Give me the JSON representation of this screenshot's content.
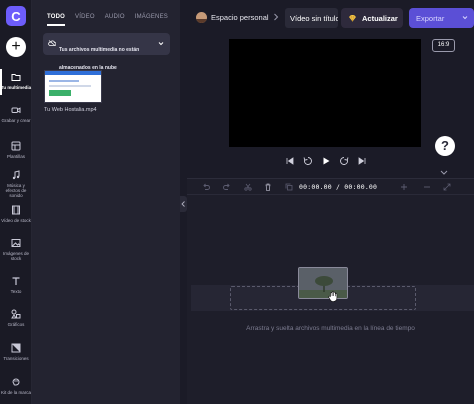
{
  "rail": {
    "logo_letter": "C",
    "add_label": "+",
    "items": [
      {
        "label": "Tu multimedia",
        "icon": "folder-icon",
        "active": true
      },
      {
        "label": "Grabar y crear",
        "icon": "video-camera-icon"
      },
      {
        "label": "Plantillas",
        "icon": "templates-icon"
      },
      {
        "label": "Música y efectos de sonido",
        "icon": "music-note-icon"
      },
      {
        "label": "Vídeo de stock",
        "icon": "film-icon"
      },
      {
        "label": "Imágenes de stock",
        "icon": "image-icon"
      },
      {
        "label": "Texto",
        "icon": "text-icon"
      },
      {
        "label": "Gráficos",
        "icon": "shapes-icon"
      },
      {
        "label": "Transiciones",
        "icon": "transitions-icon"
      },
      {
        "label": "Kit de la marca",
        "icon": "brand-kit-icon"
      }
    ]
  },
  "panel": {
    "tabs": [
      "TODO",
      "VÍDEO",
      "AUDIO",
      "IMÁGENES"
    ],
    "notice": "Tus archivos multimedia no están almacenados en la nube",
    "media_item_name": "Tu Web Hostalia.mp4"
  },
  "topbar": {
    "workspace": "Espacio personal",
    "video_title": "Vídeo sin título",
    "upgrade_label": "Actualizar",
    "export_label": "Exportar"
  },
  "preview": {
    "aspect_ratio": "16:9",
    "help_label": "?"
  },
  "timeline": {
    "timecode": "00:00.00 / 00:00.00",
    "hint": "Arrastra y suelta archivos multimedia en la línea de tiempo"
  },
  "colors": {
    "accent": "#6d5dfb",
    "export_bg": "#5b4fd6",
    "upgrade_gem": "#f5c74a"
  }
}
